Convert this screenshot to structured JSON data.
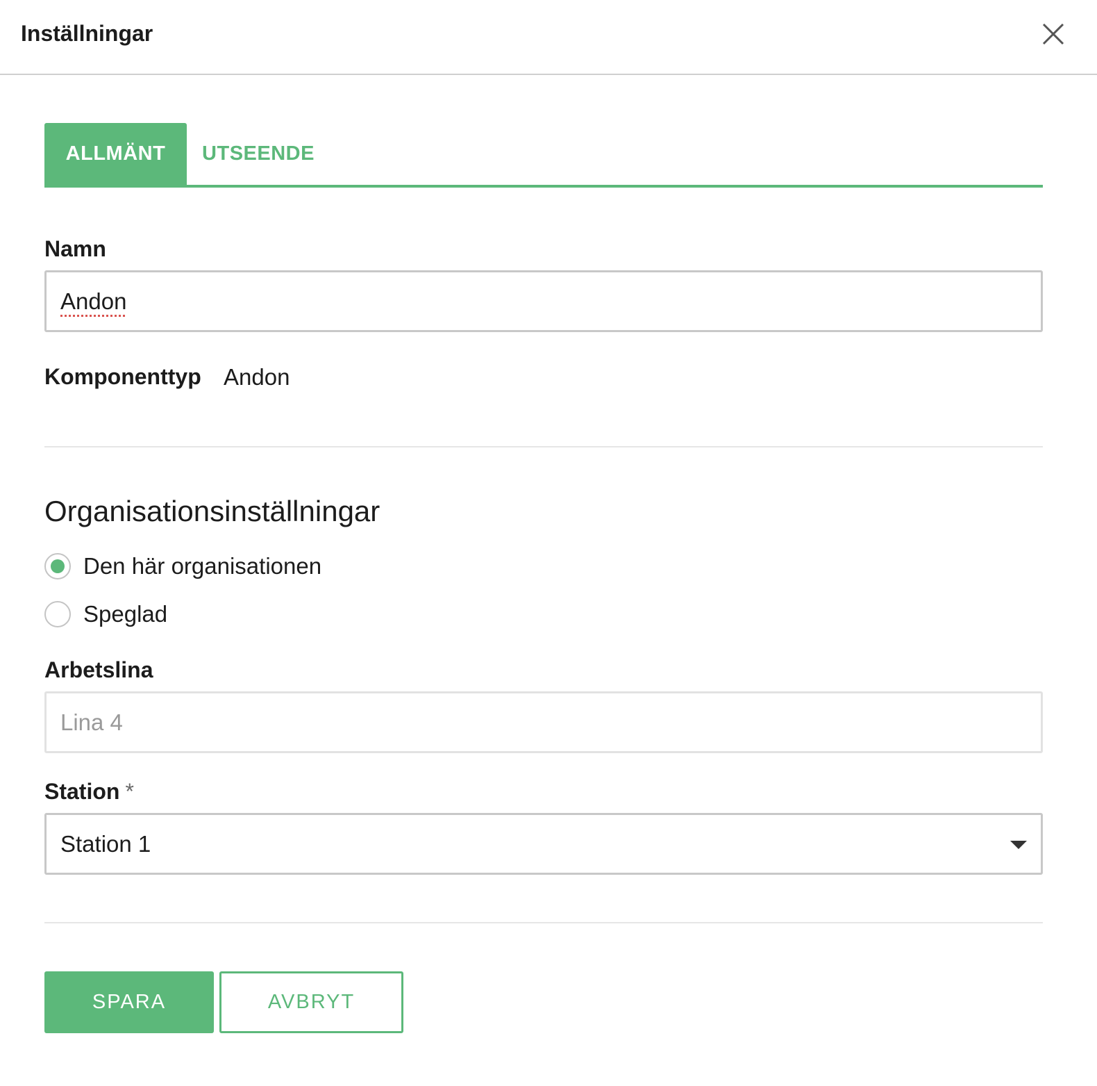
{
  "dialog": {
    "title": "Inställningar",
    "close_icon": "close-icon"
  },
  "tabs": [
    {
      "label": "ALLMÄNT",
      "active": true
    },
    {
      "label": "UTSEENDE",
      "active": false
    }
  ],
  "form": {
    "name_label": "Namn",
    "name_value": "Andon",
    "component_type_label": "Komponenttyp",
    "component_type_value": "Andon"
  },
  "organization": {
    "heading": "Organisationsinställningar",
    "options": [
      {
        "label": "Den här organisationen",
        "selected": true
      },
      {
        "label": "Speglad",
        "selected": false
      }
    ]
  },
  "work_line": {
    "label": "Arbetslina",
    "value": "Lina 4"
  },
  "station": {
    "label": "Station",
    "required_marker": "*",
    "selected": "Station 1"
  },
  "actions": {
    "save_label": "SPARA",
    "cancel_label": "AVBRYT"
  },
  "colors": {
    "accent": "#5cb87a",
    "text": "#1c1c1c",
    "border": "#c8c8c8",
    "disabled_text": "#9a9a9a"
  }
}
